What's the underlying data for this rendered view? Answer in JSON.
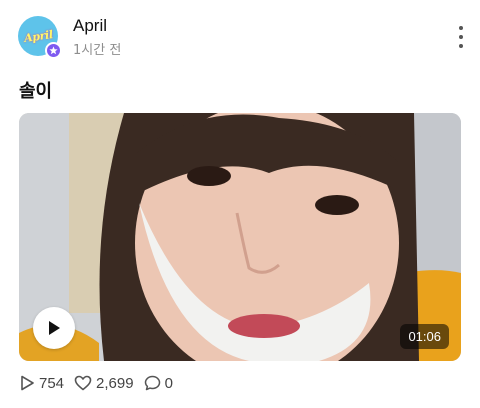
{
  "post": {
    "author": {
      "name": "April",
      "avatar_text": "April",
      "badge_icon": "star-icon",
      "avatar_color": "#5ec3ea",
      "badge_color": "#7e5bf0"
    },
    "time": "1시간 전",
    "menu_icon": "more-vertical-icon",
    "title": "솔이",
    "video": {
      "duration": "01:06",
      "play_icon": "play-icon"
    },
    "stats": {
      "views": "754",
      "likes": "2,699",
      "comments": "0"
    }
  }
}
